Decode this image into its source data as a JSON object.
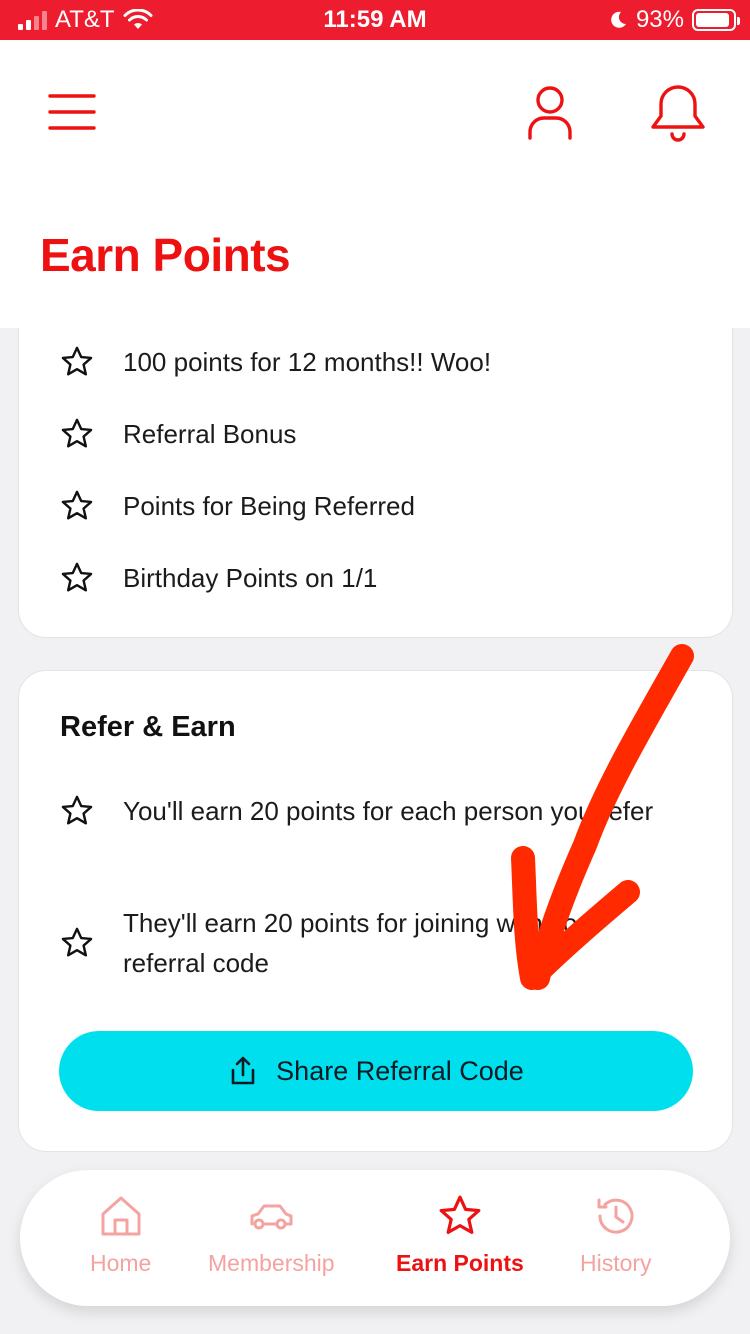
{
  "status_bar": {
    "carrier": "AT&T",
    "time": "11:59 AM",
    "battery": "93%",
    "battery_level": 0.93
  },
  "header": {
    "title": "Earn Points",
    "icons": [
      "hamburger-menu-icon",
      "user-icon",
      "bell-icon"
    ]
  },
  "earn_list": {
    "items": [
      {
        "label": "100 points for 12 months!! Woo!"
      },
      {
        "label": "Referral Bonus"
      },
      {
        "label": "Points for Being Referred"
      },
      {
        "label": "Birthday Points on 1/1"
      }
    ]
  },
  "refer_card": {
    "title": "Refer & Earn",
    "items": [
      {
        "label": "You'll earn 20 points for each person you refer"
      },
      {
        "label": "They'll earn 20 points for joining with your referral code"
      }
    ],
    "share_button": "Share Referral Code"
  },
  "bottom_nav": {
    "items": [
      {
        "label": "Home",
        "icon": "home-icon"
      },
      {
        "label": "Membership",
        "icon": "car-icon"
      },
      {
        "label": "Earn Points",
        "icon": "star-icon",
        "active": true
      },
      {
        "label": "History",
        "icon": "history-icon"
      }
    ]
  },
  "colors": {
    "brand_red": "#ed1111",
    "status_bar": "#ed1c2e",
    "accent_cyan": "#00dfee",
    "nav_inactive": "#f4a3a0",
    "annotation_arrow": "#ff2a00"
  }
}
